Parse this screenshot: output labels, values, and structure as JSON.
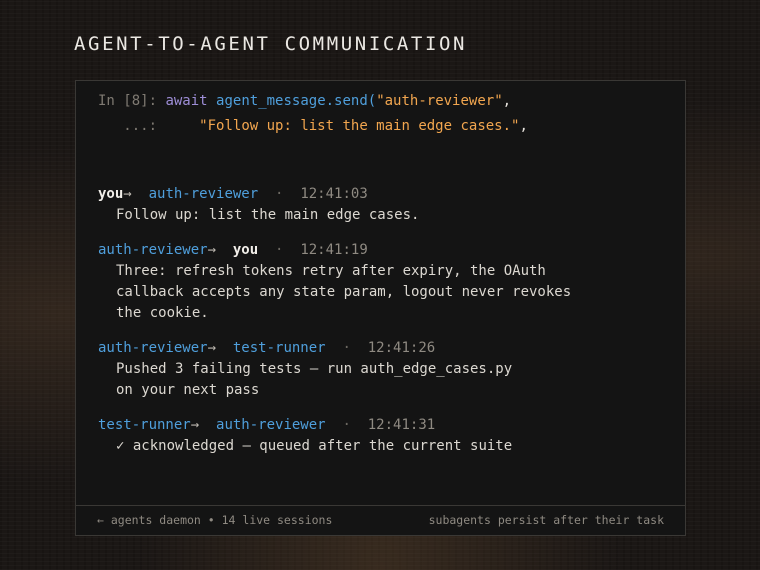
{
  "title": "AGENT-TO-AGENT COMMUNICATION",
  "cell": {
    "prompt_in": "In [8]:",
    "prompt_cont": "...:",
    "kw": "await",
    "fn": "agent_message.send(",
    "arg1": "\"auth-reviewer\"",
    "comma1": ",",
    "arg2": "\"Follow up: list the main edge cases.\"",
    "comma2": ","
  },
  "messages": [
    {
      "from": "you",
      "to": "auth-reviewer",
      "time": "12:41:03",
      "lines": [
        "Follow up: list the main edge cases."
      ]
    },
    {
      "from": "auth-reviewer",
      "to": "you",
      "time": "12:41:19",
      "lines": [
        "Three: refresh tokens retry after expiry, the OAuth",
        "callback accepts any state param, logout never revokes",
        "the cookie."
      ]
    },
    {
      "from": "auth-reviewer",
      "to": "test-runner",
      "time": "12:41:26",
      "lines": [
        "Pushed 3 failing tests — run auth_edge_cases.py",
        "on your next pass"
      ]
    },
    {
      "from": "test-runner",
      "to": "auth-reviewer",
      "time": "12:41:31",
      "check": "✓",
      "lines": [
        "acknowledged — queued after the current suite"
      ]
    }
  ],
  "arrow": "→",
  "separator": "·",
  "footer": {
    "left": "← agents daemon • 14 live sessions",
    "right": "subagents persist after their task"
  }
}
